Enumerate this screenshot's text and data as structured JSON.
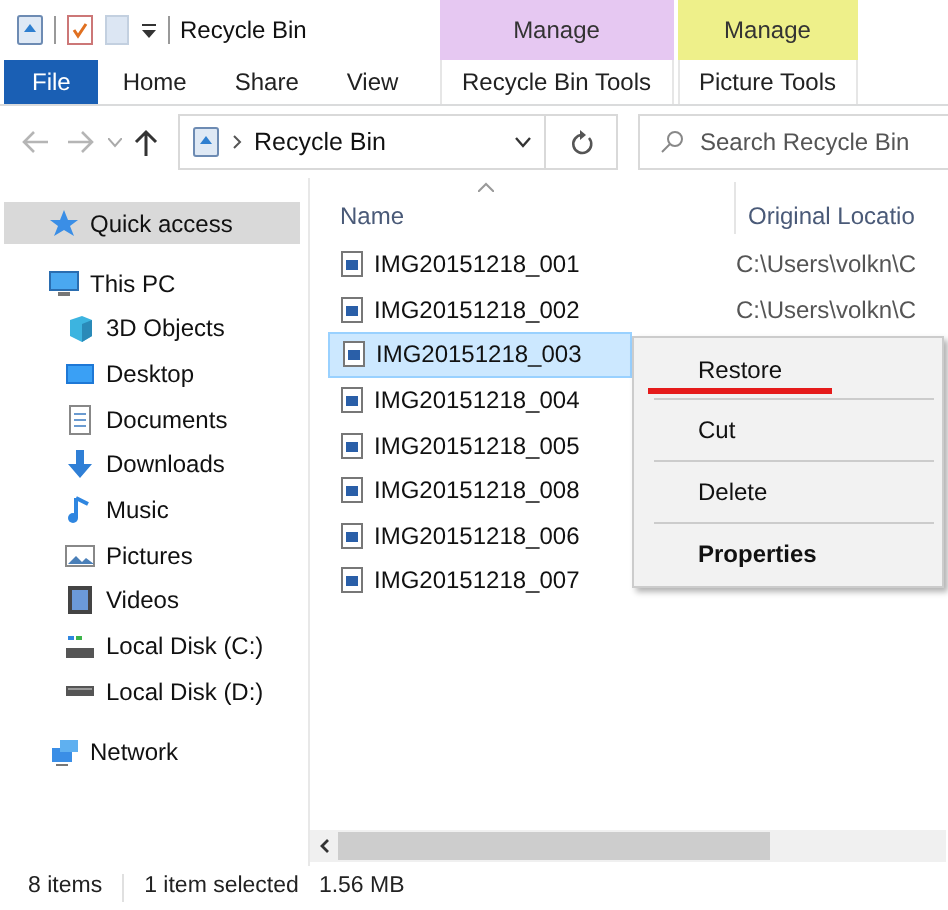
{
  "window": {
    "title": "Recycle Bin"
  },
  "context_groups": [
    {
      "label": "Manage",
      "color": "#e6c8f2",
      "tab": {
        "label": "Recycle Bin Tools",
        "selected": false
      }
    },
    {
      "label": "Manage",
      "color": "#eef08a",
      "tab": {
        "label": "Picture Tools",
        "selected": false
      }
    }
  ],
  "tabs": [
    {
      "label": "File",
      "kind": "file",
      "selected": false
    },
    {
      "label": "Home",
      "kind": "tab",
      "selected": false
    },
    {
      "label": "Share",
      "kind": "tab",
      "selected": false
    },
    {
      "label": "View",
      "kind": "tab",
      "selected": false
    }
  ],
  "nav": {
    "back_disabled": true,
    "forward_disabled": true
  },
  "address": {
    "path": "Recycle Bin"
  },
  "search": {
    "placeholder": "Search Recycle Bin"
  },
  "sidebar": {
    "items": [
      {
        "label": "Quick access",
        "selected": true
      },
      {
        "label": "This PC",
        "selected": false,
        "children": [
          {
            "label": "3D Objects",
            "selected": false
          },
          {
            "label": "Desktop",
            "selected": false
          },
          {
            "label": "Documents",
            "selected": false
          },
          {
            "label": "Downloads",
            "selected": false
          },
          {
            "label": "Music",
            "selected": false
          },
          {
            "label": "Pictures",
            "selected": false
          },
          {
            "label": "Videos",
            "selected": false
          },
          {
            "label": "Local Disk (C:)",
            "selected": false
          },
          {
            "label": "Local Disk (D:)",
            "selected": false
          }
        ]
      },
      {
        "label": "Network",
        "selected": false
      }
    ]
  },
  "table": {
    "columns": [
      "Name",
      "Original Locatio"
    ],
    "rows": [
      {
        "name": "IMG20151218_001",
        "location": "C:\\Users\\volkn\\C",
        "selected": false
      },
      {
        "name": "IMG20151218_002",
        "location": "C:\\Users\\volkn\\C",
        "selected": false
      },
      {
        "name": "IMG20151218_003",
        "selected": true
      },
      {
        "name": "IMG20151218_004",
        "selected": false
      },
      {
        "name": "IMG20151218_005",
        "selected": false
      },
      {
        "name": "IMG20151218_008",
        "selected": false
      },
      {
        "name": "IMG20151218_006",
        "selected": false
      },
      {
        "name": "IMG20151218_007",
        "selected": false
      }
    ]
  },
  "context_menu": {
    "items": [
      {
        "label": "Restore",
        "default": false,
        "underlined": true
      },
      {
        "label": "Cut",
        "default": false,
        "underlined": false
      },
      {
        "label": "Delete",
        "default": false,
        "underlined": false
      },
      {
        "label": "Properties",
        "default": true,
        "underlined": false
      }
    ]
  },
  "status_bar": {
    "count": "8 items",
    "selection": "1 item selected",
    "size": "1.56 MB"
  }
}
